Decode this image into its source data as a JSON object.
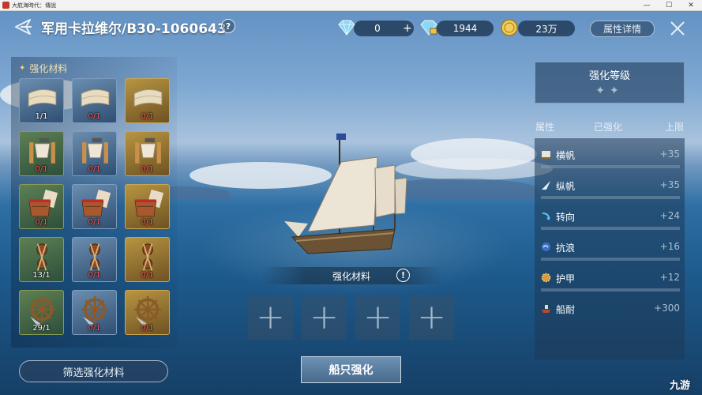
{
  "window": {
    "title": "大航海時代：傳說",
    "minimize_glyph": "—",
    "maximize_glyph": "☐",
    "close_glyph": "✕"
  },
  "header": {
    "ship_name": "军用卡拉维尔/B30-1060643",
    "help_glyph": "?",
    "currencies": [
      {
        "icon": "diamond-icon",
        "value": "0",
        "has_plus": true
      },
      {
        "icon": "locked-diamond-icon",
        "value": "1944",
        "has_plus": false
      },
      {
        "icon": "gold-coin-icon",
        "value": "23万",
        "has_plus": false
      }
    ],
    "plus_glyph": "+",
    "attr_detail_label": "属性详情"
  },
  "materials": {
    "title": "强化材料",
    "items": [
      {
        "art": "sail-cloth-icon",
        "count": "1/1",
        "tier": "blue",
        "short": false
      },
      {
        "art": "sail-cloth-icon",
        "count": "0/1",
        "tier": "blue",
        "short": true
      },
      {
        "art": "sail-cloth-icon",
        "count": "0/1",
        "tier": "gold",
        "short": true
      },
      {
        "art": "wood-tools-icon",
        "count": "0/1",
        "tier": "green",
        "short": true
      },
      {
        "art": "wood-tools-icon",
        "count": "0/1",
        "tier": "blue",
        "short": true
      },
      {
        "art": "wood-tools-icon",
        "count": "0/1",
        "tier": "gold",
        "short": true
      },
      {
        "art": "bucket-map-icon",
        "count": "0/1",
        "tier": "green",
        "short": true
      },
      {
        "art": "bucket-map-icon",
        "count": "0/1",
        "tier": "blue",
        "short": true
      },
      {
        "art": "bucket-map-icon",
        "count": "0/1",
        "tier": "gold",
        "short": true
      },
      {
        "art": "rigging-pulley-icon",
        "count": "13/1",
        "tier": "green",
        "short": false
      },
      {
        "art": "rigging-pulley-icon",
        "count": "0/1",
        "tier": "blue",
        "short": true
      },
      {
        "art": "rigging-pulley-icon",
        "count": "0/1",
        "tier": "gold",
        "short": true
      },
      {
        "art": "ship-wheel-icon",
        "count": "29/1",
        "tier": "green",
        "short": false
      },
      {
        "art": "ship-wheel-icon",
        "count": "0/1",
        "tier": "blue",
        "short": true
      },
      {
        "art": "ship-wheel-icon",
        "count": "0/1",
        "tier": "gold",
        "short": true
      },
      {
        "art": "ship-wheel-icon",
        "count": "",
        "tier": "green",
        "short": false
      },
      {
        "art": "ship-wheel-icon",
        "count": "",
        "tier": "blue",
        "short": false
      },
      {
        "art": "ship-wheel-icon",
        "count": "",
        "tier": "gold",
        "short": false
      }
    ],
    "filter_label": "筛选强化材料"
  },
  "center": {
    "material_bar_label": "强化材料",
    "info_glyph": "!",
    "slot_glyph": "+",
    "enhance_label": "船只强化"
  },
  "stats": {
    "level_title": "强化等级",
    "level_stars": "✦✦",
    "col_attr": "属性",
    "col_enhanced": "已强化",
    "col_limit": "上限",
    "rows": [
      {
        "icon": "horizontal-sail-icon",
        "name": "横帆",
        "value": "+35"
      },
      {
        "icon": "vertical-sail-icon",
        "name": "纵帆",
        "value": "+35"
      },
      {
        "icon": "turning-icon",
        "name": "转向",
        "value": "+24"
      },
      {
        "icon": "wave-icon",
        "name": "抗浪",
        "value": "+16"
      },
      {
        "icon": "armor-icon",
        "name": "护甲",
        "value": "+12"
      },
      {
        "icon": "hull-icon",
        "name": "船耐",
        "value": "+300"
      }
    ]
  },
  "watermark": "九游"
}
